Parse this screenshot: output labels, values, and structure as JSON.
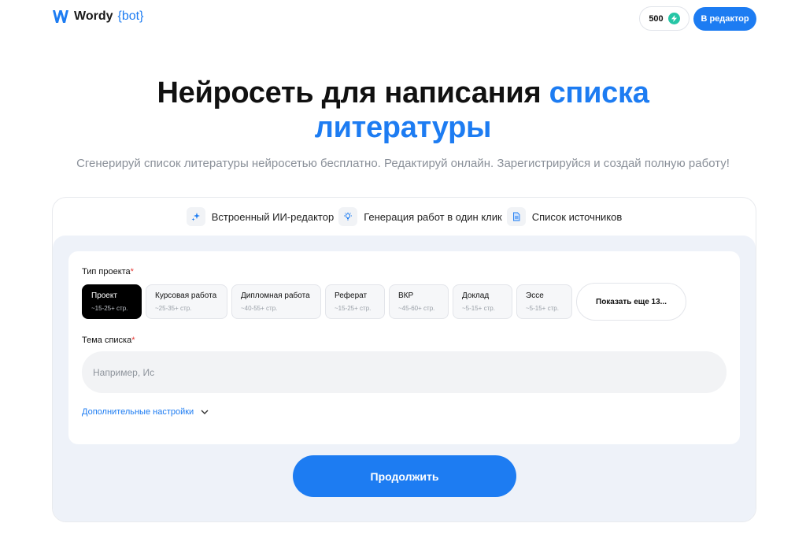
{
  "header": {
    "logo_text": "Wordy",
    "logo_suffix": "{bot}",
    "credits": "500",
    "editor_button": "В редактор"
  },
  "hero": {
    "title_main": "Нейросеть для написания ",
    "title_accent_1": "списка",
    "title_accent_2": "литературы",
    "subtitle": "Сгенерируй список литературы нейросетью бесплатно. Редактируй онлайн. Зарегистрируйся и создай полную работу!"
  },
  "features": [
    {
      "label": "Встроенный ИИ-редактор",
      "icon": "sparkles-icon"
    },
    {
      "label": "Генерация работ в один клик",
      "icon": "lightbulb-icon"
    },
    {
      "label": "Список источников",
      "icon": "document-icon"
    }
  ],
  "form": {
    "project_type_label": "Тип проекта",
    "required_mark": "*",
    "project_types": [
      {
        "name": "Проект",
        "pages": "~15-25+ стр.",
        "active": true
      },
      {
        "name": "Курсовая работа",
        "pages": "~25-35+ стр.",
        "active": false
      },
      {
        "name": "Дипломная работа",
        "pages": "~40-55+ стр.",
        "active": false
      },
      {
        "name": "Реферат",
        "pages": "~15-25+ стр.",
        "active": false
      },
      {
        "name": "ВКР",
        "pages": "~45-60+ стр.",
        "active": false
      },
      {
        "name": "Доклад",
        "pages": "~5-15+ стр.",
        "active": false
      },
      {
        "name": "Эссе",
        "pages": "~5-15+ стр.",
        "active": false
      }
    ],
    "show_more": "Показать еще 13...",
    "topic_label": "Тема списка",
    "topic_placeholder": "Например, Ис",
    "topic_value": "",
    "advanced_settings": "Дополнительные настройки",
    "continue_button": "Продолжить"
  },
  "colors": {
    "accent": "#1d7cf2",
    "credit_badge": "#26c6a6",
    "required": "#e53935"
  }
}
